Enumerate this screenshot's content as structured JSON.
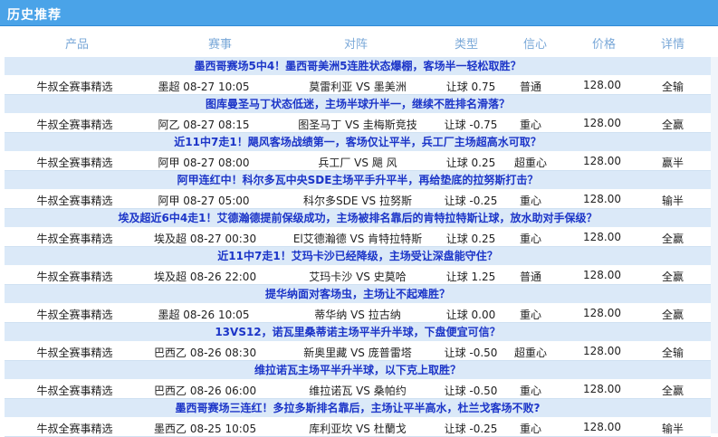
{
  "header": {
    "title": "历史推荐"
  },
  "columns": {
    "product": "产品",
    "event": "赛事",
    "match": "对阵",
    "type": "类型",
    "confidence": "信心",
    "price": "价格",
    "detail": "详情"
  },
  "rows": [
    {
      "title": "墨西哥赛场5中4！墨西哥美洲5连胜状态爆棚，客场半一轻松取胜？",
      "product": "牛叔全赛事精选",
      "event": "墨超 08-27 10:05",
      "match": "莫雷利亚 VS 墨美洲",
      "type": "让球 0.75",
      "confidence": "普通",
      "price": "128.00",
      "result": "全输"
    },
    {
      "title": "图库曼圣马丁状态低迷，主场半球升半一，继续不胜排名滑落？",
      "product": "牛叔全赛事精选",
      "event": "阿乙 08-27 08:15",
      "match": "图圣马丁 VS 圭梅斯竞技",
      "type": "让球 -0.75",
      "confidence": "重心",
      "price": "128.00",
      "result": "全赢"
    },
    {
      "title": "近11中7走1！飓风客场战绩第一，客场仅让平半，兵工厂主场超高水可取？",
      "product": "牛叔全赛事精选",
      "event": "阿甲 08-27 08:00",
      "match": "兵工厂 VS 飓 风",
      "type": "让球 0.25",
      "confidence": "超重心",
      "price": "128.00",
      "result": "赢半"
    },
    {
      "title": "阿甲连红中！科尔多瓦中央SDE主场平手升平半，再给垫底的拉努斯打击？",
      "product": "牛叔全赛事精选",
      "event": "阿甲 08-27 05:00",
      "match": "科尔多SDE VS 拉努斯",
      "type": "让球 -0.25",
      "confidence": "重心",
      "price": "128.00",
      "result": "输半"
    },
    {
      "title": "埃及超近6中4走1！艾德瀚德提前保级成功，主场被排名靠后的肯特拉特斯让球，放水助对手保级？",
      "product": "牛叔全赛事精选",
      "event": "埃及超 08-27 00:30",
      "match": "El艾德瀚德 VS 肯特拉特斯",
      "type": "让球 0.25",
      "confidence": "重心",
      "price": "128.00",
      "result": "全赢"
    },
    {
      "title": "近11中7走1！艾玛卡沙已经降级，主场受让深盘能守住？",
      "product": "牛叔全赛事精选",
      "event": "埃及超 08-26 22:00",
      "match": "艾玛卡沙 VS 史莫哈",
      "type": "让球 1.25",
      "confidence": "普通",
      "price": "128.00",
      "result": "全赢"
    },
    {
      "title": "提华纳面对客场虫，主场让不起难胜？",
      "product": "牛叔全赛事精选",
      "event": "墨超 08-26 10:05",
      "match": "蒂华纳 VS 拉古纳",
      "type": "让球 0.00",
      "confidence": "重心",
      "price": "128.00",
      "result": "全赢"
    },
    {
      "title": "13VS12，诺瓦里桑蒂诺主场平半升半球，下盘便宜可信？",
      "product": "牛叔全赛事精选",
      "event": "巴西乙 08-26 08:30",
      "match": "新奥里藏 VS 庞普雷塔",
      "type": "让球 -0.50",
      "confidence": "超重心",
      "price": "128.00",
      "result": "全输"
    },
    {
      "title": "维拉诺瓦主场平半升半球，以下克上取胜？",
      "product": "牛叔全赛事精选",
      "event": "巴西乙 08-26 06:00",
      "match": "维拉诺瓦 VS 桑帕约",
      "type": "让球 -0.50",
      "confidence": "重心",
      "price": "128.00",
      "result": "全赢"
    },
    {
      "title": "墨西哥赛场三连红！多拉多斯排名靠后，主场让平半高水，杜兰戈客场不败?",
      "product": "牛叔全赛事精选",
      "event": "墨西乙 08-25 10:05",
      "match": "库利亚坎 VS 杜蘭戈",
      "type": "让球 -0.25",
      "confidence": "重心",
      "price": "128.00",
      "result": "输半"
    }
  ],
  "colors": {
    "header_bg": "#4aa3e8",
    "title_bg": "#dbe9f8",
    "link": "#1c35c8",
    "col_head": "#7aa8d8"
  }
}
